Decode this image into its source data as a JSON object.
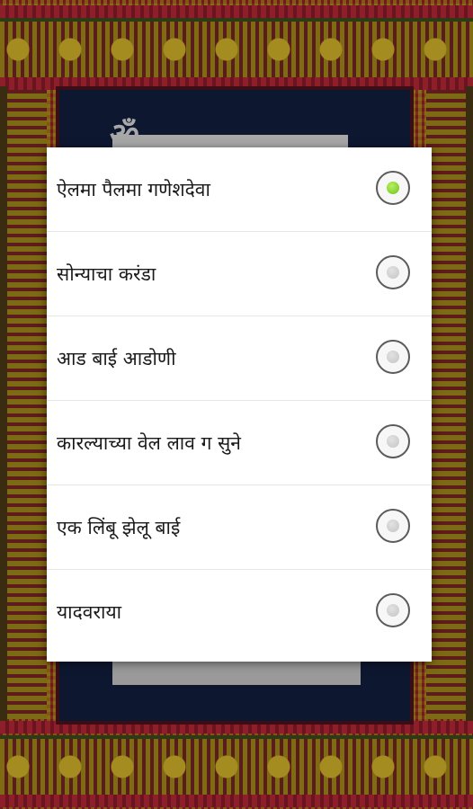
{
  "background": {
    "heading_text": "ॐ"
  },
  "dialog": {
    "options": [
      {
        "label": "ऐलमा पैलमा गणेशदेवा",
        "selected": true
      },
      {
        "label": "सोन्याचा करंडा",
        "selected": false
      },
      {
        "label": "आड बाई आडोणी",
        "selected": false
      },
      {
        "label": "कारल्याच्या वेल लाव ग सुने",
        "selected": false
      },
      {
        "label": "एक लिंबू झेलू बाई",
        "selected": false
      },
      {
        "label": "यादवराया",
        "selected": false
      }
    ]
  },
  "colors": {
    "selected_radio": "#6cc21c",
    "panel": "#0e1730",
    "frame_gold": "#7e6b12",
    "frame_red": "#8c1f2a"
  },
  "icons": {
    "radio_selected": "radio-selected-icon",
    "radio_unselected": "radio-unselected-icon"
  }
}
